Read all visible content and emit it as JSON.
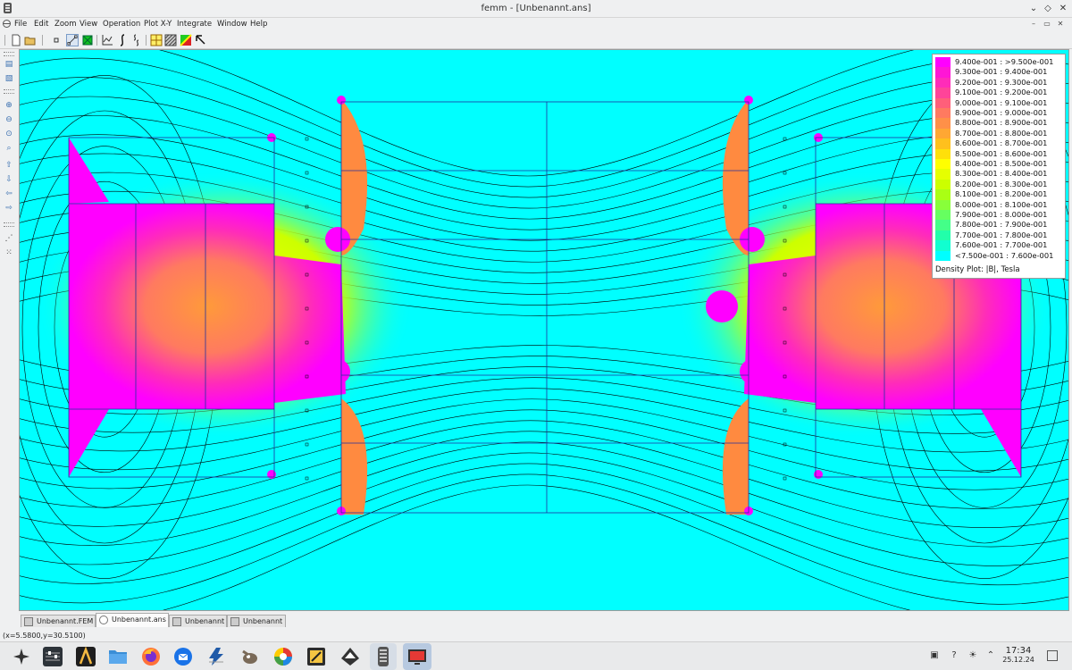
{
  "window": {
    "title": "femm - [Unbenannt.ans]",
    "controls": [
      "⌄",
      "◇",
      "✕"
    ]
  },
  "menu": [
    "File",
    "Edit",
    "Zoom",
    "View",
    "Operation",
    "Plot X-Y",
    "Integrate",
    "Window",
    "Help"
  ],
  "toolbar_icons": [
    "new-file-icon",
    "open-folder-icon",
    "point-mode-icon",
    "contour-mode-icon",
    "area-mode-icon",
    "plot-xy-icon",
    "line-integral-icon",
    "block-integral-icon",
    "mesh-toggle-icon",
    "density-plot-icon",
    "vector-plot-icon",
    "pointer-icon"
  ],
  "left_toolbar_icons": [
    "show-results-icon",
    "show-values-icon",
    "zoom-in-icon",
    "zoom-out-icon",
    "zoom-natural-icon",
    "zoom-window-icon",
    "pan-up-icon",
    "pan-down-icon",
    "pan-left-icon",
    "pan-right-icon",
    "show-points-icon",
    "show-mesh-icon"
  ],
  "legend": {
    "rows": [
      {
        "label": "9.400e-001 : >9.500e-001",
        "color": "#ff00ff"
      },
      {
        "label": "9.300e-001 : 9.400e-001",
        "color": "#ff16d6"
      },
      {
        "label": "9.200e-001 : 9.300e-001",
        "color": "#ff2cb9"
      },
      {
        "label": "9.100e-001 : 9.200e-001",
        "color": "#ff4499"
      },
      {
        "label": "9.000e-001 : 9.100e-001",
        "color": "#ff5f7a"
      },
      {
        "label": "8.900e-001 : 9.000e-001",
        "color": "#ff7a60"
      },
      {
        "label": "8.800e-001 : 8.900e-001",
        "color": "#ff9048"
      },
      {
        "label": "8.700e-001 : 8.800e-001",
        "color": "#ffa733"
      },
      {
        "label": "8.600e-001 : 8.700e-001",
        "color": "#ffc01d"
      },
      {
        "label": "8.500e-001 : 8.600e-001",
        "color": "#ffe00a"
      },
      {
        "label": "8.400e-001 : 8.500e-001",
        "color": "#ffff00"
      },
      {
        "label": "8.300e-001 : 8.400e-001",
        "color": "#e6ff00"
      },
      {
        "label": "8.200e-001 : 8.300e-001",
        "color": "#ccff00"
      },
      {
        "label": "8.100e-001 : 8.200e-001",
        "color": "#aaff14"
      },
      {
        "label": "8.000e-001 : 8.100e-001",
        "color": "#88ff3a"
      },
      {
        "label": "7.900e-001 : 8.000e-001",
        "color": "#66ff60"
      },
      {
        "label": "7.800e-001 : 7.900e-001",
        "color": "#44ff88"
      },
      {
        "label": "7.700e-001 : 7.800e-001",
        "color": "#22ffaa"
      },
      {
        "label": "7.600e-001 : 7.700e-001",
        "color": "#11ffd0"
      },
      {
        "label": "<7.500e-001 : 7.600e-001",
        "color": "#00ffff"
      }
    ],
    "caption": "Density Plot: |B|, Tesla"
  },
  "tabs": [
    {
      "label": "Unbenannt.FEM",
      "active": false
    },
    {
      "label": "Unbenannt.ans",
      "active": true
    },
    {
      "label": "Unbenannt",
      "active": false
    },
    {
      "label": "Unbenannt",
      "active": false
    }
  ],
  "status_text": "(x=5.5800,y=30.5100)",
  "taskbar": {
    "apps": [
      "launcher-icon",
      "mixer-icon",
      "app-icon",
      "files-icon",
      "firefox-icon",
      "thunderbird-icon",
      "inkscape-icon",
      "gimp-icon",
      "color-wheel-icon",
      "editor-icon",
      "inkscape-alt-icon",
      "femm-icon",
      "screen-icon"
    ],
    "time": "17:34",
    "date": "25.12.24"
  }
}
